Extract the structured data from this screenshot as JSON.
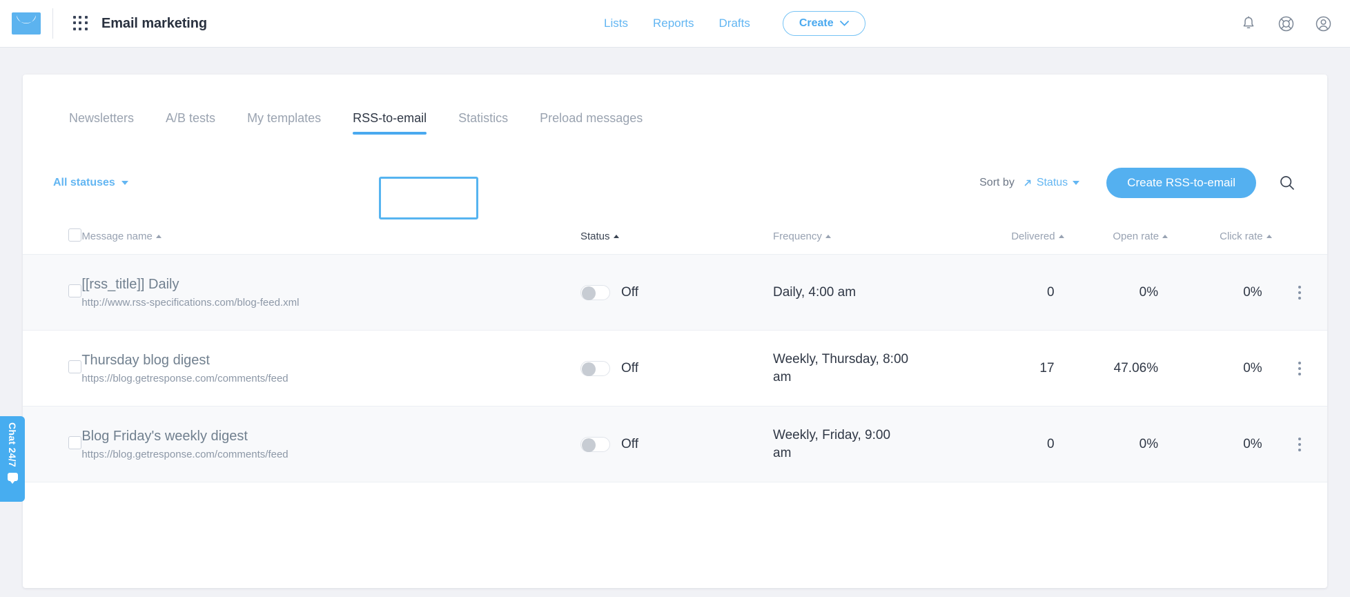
{
  "header": {
    "logo_icon": "envelope-logo",
    "apps_icon": "grid-apps-icon",
    "app_title": "Email marketing",
    "nav": [
      {
        "label": "Lists"
      },
      {
        "label": "Reports"
      },
      {
        "label": "Drafts"
      }
    ],
    "create_button": {
      "label": "Create",
      "icon": "chevron-down-icon"
    },
    "right_icons": [
      {
        "name": "notifications-bell-icon"
      },
      {
        "name": "help-lifebuoy-icon"
      },
      {
        "name": "user-account-icon"
      }
    ]
  },
  "tabs": [
    {
      "label": "Newsletters",
      "active": false
    },
    {
      "label": "A/B tests",
      "active": false
    },
    {
      "label": "My templates",
      "active": false
    },
    {
      "label": "RSS-to-email",
      "active": true
    },
    {
      "label": "Statistics",
      "active": false
    },
    {
      "label": "Preload messages",
      "active": false
    }
  ],
  "toolbar": {
    "status_filter_label": "All statuses",
    "sort_by_label": "Sort by",
    "sort_value": "Status",
    "create_rss_label": "Create RSS-to-email",
    "search_icon": "search-icon"
  },
  "table": {
    "columns": {
      "message_name": "Message name",
      "status": "Status",
      "frequency": "Frequency",
      "delivered": "Delivered",
      "open_rate": "Open rate",
      "click_rate": "Click rate"
    },
    "rows": [
      {
        "title": "[[rss_title]] Daily",
        "url": "http://www.rss-specifications.com/blog-feed.xml",
        "status": "Off",
        "frequency": "Daily, 4:00 am",
        "delivered": "0",
        "open_rate": "0%",
        "click_rate": "0%"
      },
      {
        "title": "Thursday blog digest",
        "url": "https://blog.getresponse.com/comments/feed",
        "status": "Off",
        "frequency": "Weekly, Thursday, 8:00 am",
        "delivered": "17",
        "open_rate": "47.06%",
        "click_rate": "0%"
      },
      {
        "title": "Blog Friday's weekly digest",
        "url": "https://blog.getresponse.com/comments/feed",
        "status": "Off",
        "frequency": "Weekly, Friday, 9:00 am",
        "delivered": "0",
        "open_rate": "0%",
        "click_rate": "0%"
      }
    ]
  },
  "chat_widget": {
    "label": "Chat 24/7",
    "icon": "chat-bubble-icon"
  },
  "colors": {
    "accent": "#54b0f0",
    "link": "#63b6f2",
    "page_background": "#f1f2f6",
    "text_dark": "#2f3745",
    "text_muted": "#98a2b2"
  }
}
